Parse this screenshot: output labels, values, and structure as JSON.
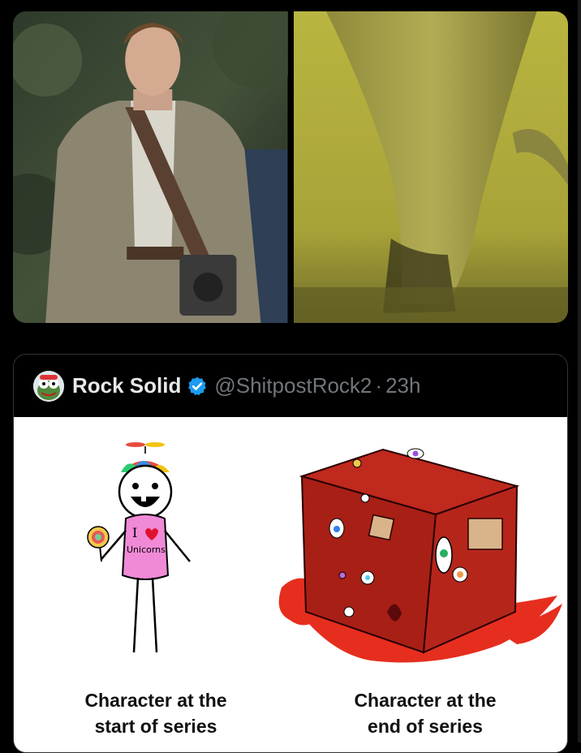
{
  "media": {
    "left_image": {
      "icon": "photo-man-with-camera"
    },
    "right_image": {
      "icon": "photo-creature-leg-yellow-fog"
    }
  },
  "quoted_post": {
    "display_name": "Rock Solid",
    "handle": "@ShitpostRock2",
    "separator": "·",
    "timestamp": "23h",
    "verified_color": "#1d9bf0",
    "meme": {
      "left_caption_line1": "Character at the",
      "left_caption_line2": "start of series",
      "right_caption_line1": "Character at the",
      "right_caption_line2": "end of series",
      "shirt_text_top": "I",
      "shirt_text_bottom": "Unicorns"
    }
  }
}
